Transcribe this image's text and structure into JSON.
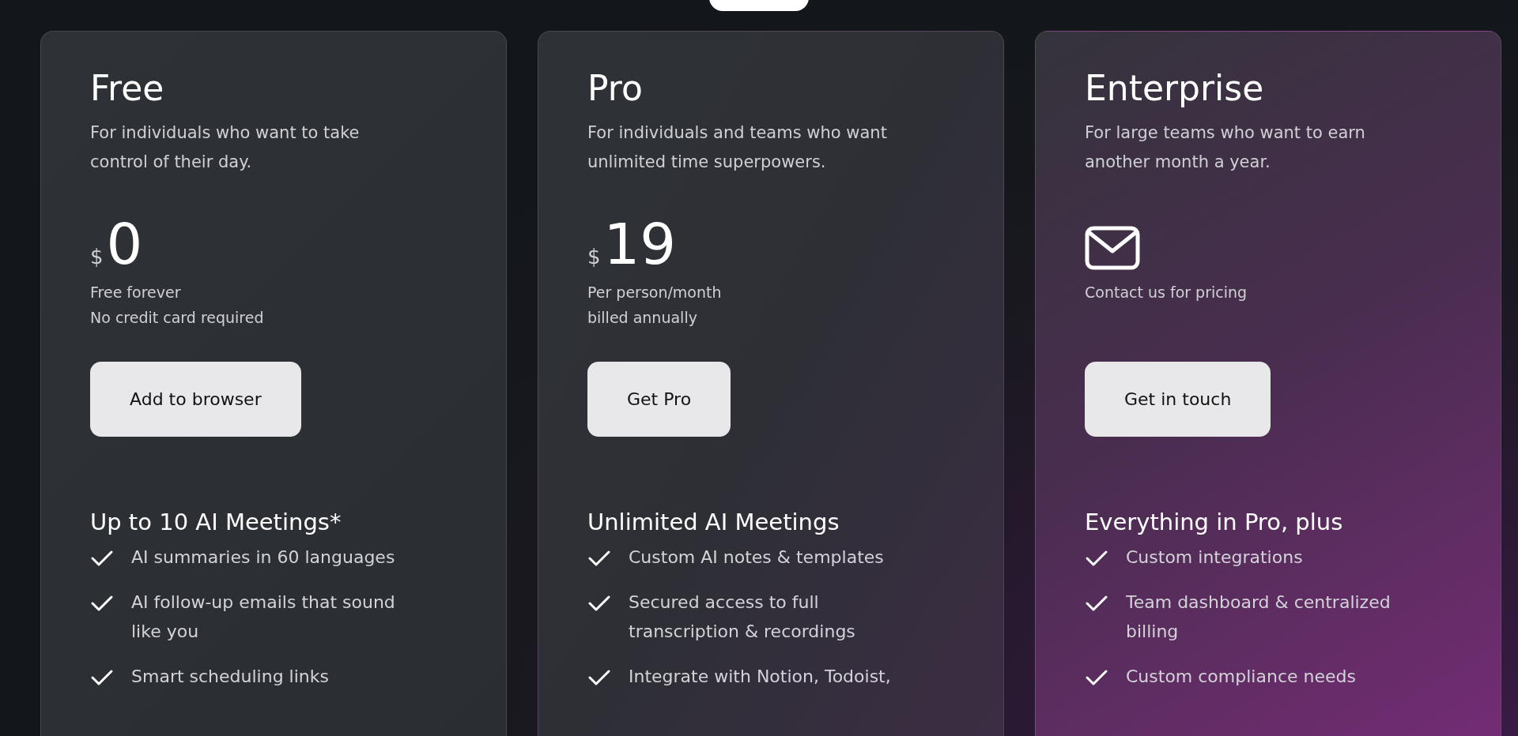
{
  "top_toggle": {
    "kind": "pill"
  },
  "plans": [
    {
      "name": "Free",
      "description": "For individuals who want to take\ncontrol of their day.",
      "pricing": {
        "kind": "price",
        "currency": "$",
        "amount": "0"
      },
      "notes": [
        "Free forever",
        "No credit card required"
      ],
      "button": "Add to browser",
      "features_heading": "Up to 10 AI Meetings*",
      "features": [
        "AI summaries in 60 languages",
        "AI follow-up emails that sound\nlike you",
        "Smart scheduling links"
      ]
    },
    {
      "name": "Pro",
      "description": "For individuals and teams who want\nunlimited time superpowers.",
      "pricing": {
        "kind": "price",
        "currency": "$",
        "amount": "19"
      },
      "notes": [
        "Per person/month",
        "billed annually"
      ],
      "button": "Get Pro",
      "features_heading": "Unlimited AI Meetings",
      "features": [
        "Custom AI notes & templates",
        "Secured access to full\ntranscription & recordings",
        "Integrate with Notion, Todoist,"
      ]
    },
    {
      "name": "Enterprise",
      "description": "For large teams who want to earn\nanother month a year.",
      "pricing": {
        "kind": "contact"
      },
      "notes": [
        "Contact us for pricing"
      ],
      "button": "Get in touch",
      "features_heading": "Everything in Pro, plus",
      "features": [
        "Custom integrations",
        "Team dashboard & centralized\nbilling",
        "Custom compliance needs"
      ]
    }
  ]
}
